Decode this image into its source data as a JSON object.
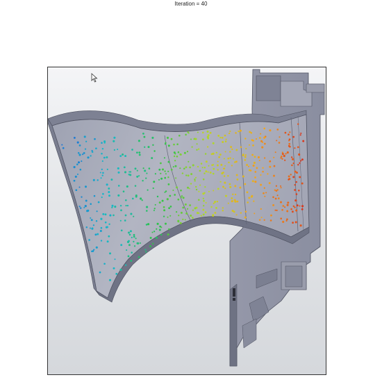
{
  "caption": "Iteration = 40",
  "viewport": {
    "background_top": "#f4f5f7",
    "background_bottom": "#d5d8dc",
    "part_color": "#8f93a4",
    "part_dark": "#6c7082",
    "part_light": "#b6b9c6",
    "cursor_icon": "mouse-pointer-icon"
  },
  "particles": {
    "color_scale": [
      "#1f6fd6",
      "#18b8c8",
      "#2dc24a",
      "#b7d72a",
      "#f2a51f",
      "#d9381e"
    ],
    "iteration": 40
  }
}
